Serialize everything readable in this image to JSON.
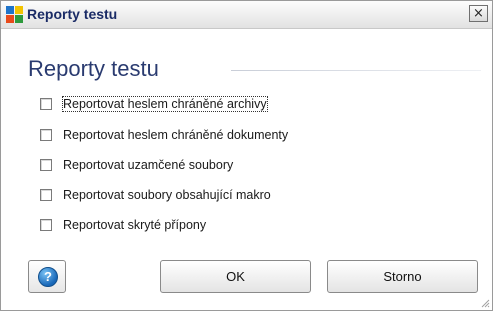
{
  "window": {
    "title": "Reporty testu",
    "close_glyph": "×",
    "icon": "avg-app-icon"
  },
  "content": {
    "heading": "Reporty testu",
    "options": [
      {
        "label": "Reportovat heslem chráněné archivy",
        "checked": false,
        "focused": true
      },
      {
        "label": "Reportovat heslem chráněné dokumenty",
        "checked": false,
        "focused": false
      },
      {
        "label": "Reportovat uzamčené soubory",
        "checked": false,
        "focused": false
      },
      {
        "label": "Reportovat soubory obsahující makro",
        "checked": false,
        "focused": false
      },
      {
        "label": "Reportovat skryté přípony",
        "checked": false,
        "focused": false
      }
    ]
  },
  "footer": {
    "help_glyph": "?",
    "ok_label": "OK",
    "cancel_label": "Storno"
  },
  "colors": {
    "title_text": "#1a2b66",
    "heading_text": "#2a3b70",
    "help_icon": "#1867b8"
  }
}
